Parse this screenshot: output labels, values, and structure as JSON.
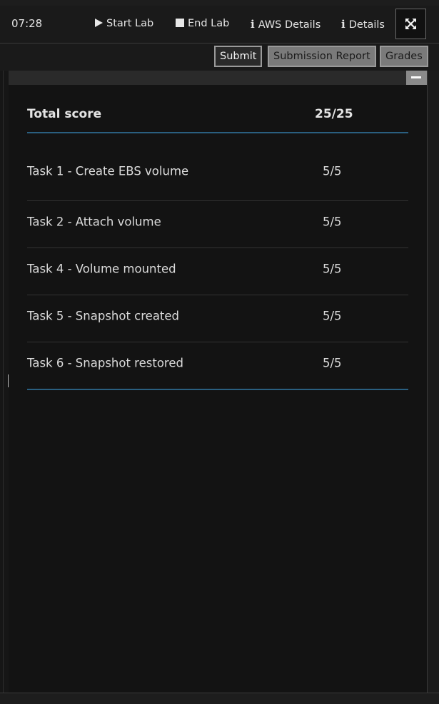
{
  "toolbar": {
    "timer": "07:28",
    "start_lab": "Start Lab",
    "end_lab": "End Lab",
    "aws_details": "AWS Details",
    "details": "Details"
  },
  "subbar": {
    "submit": "Submit",
    "submission_report": "Submission Report",
    "grades": "Grades"
  },
  "scores": {
    "total_label": "Total score",
    "total_value": "25/25",
    "tasks": [
      {
        "label": "Task 1 - Create EBS volume",
        "value": "5/5"
      },
      {
        "label": "Task 2 - Attach volume",
        "value": "5/5"
      },
      {
        "label": "Task 4 - Volume mounted",
        "value": "5/5"
      },
      {
        "label": "Task 5 - Snapshot created",
        "value": "5/5"
      },
      {
        "label": "Task 6 - Snapshot restored",
        "value": "5/5"
      }
    ]
  },
  "icons": {
    "start": "play-icon",
    "end": "stop-icon",
    "info": "info-icon",
    "expand": "expand-icon",
    "minimize": "minimize-icon"
  }
}
